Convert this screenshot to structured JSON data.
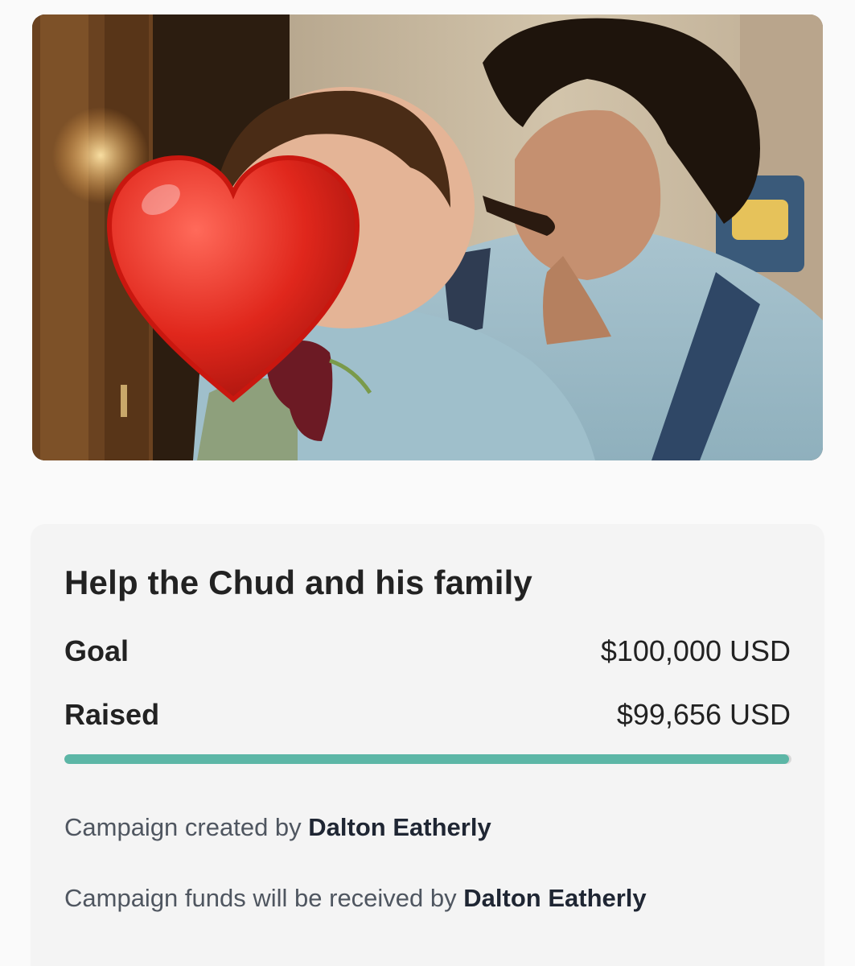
{
  "photo": {
    "heart_icon": "red-heart-icon",
    "heart_color": "#d8261c"
  },
  "campaign": {
    "title": "Help the Chud and his family",
    "goal_label": "Goal",
    "goal_value": "$100,000 USD",
    "raised_label": "Raised",
    "raised_value": "$99,656 USD",
    "progress_fraction": 0.99656,
    "progress_color": "#5cb6a6",
    "created_by_prefix": "Campaign created by",
    "created_by_name": "Dalton Eatherly",
    "received_by_prefix": "Campaign funds will be received by",
    "received_by_name": "Dalton Eatherly"
  }
}
